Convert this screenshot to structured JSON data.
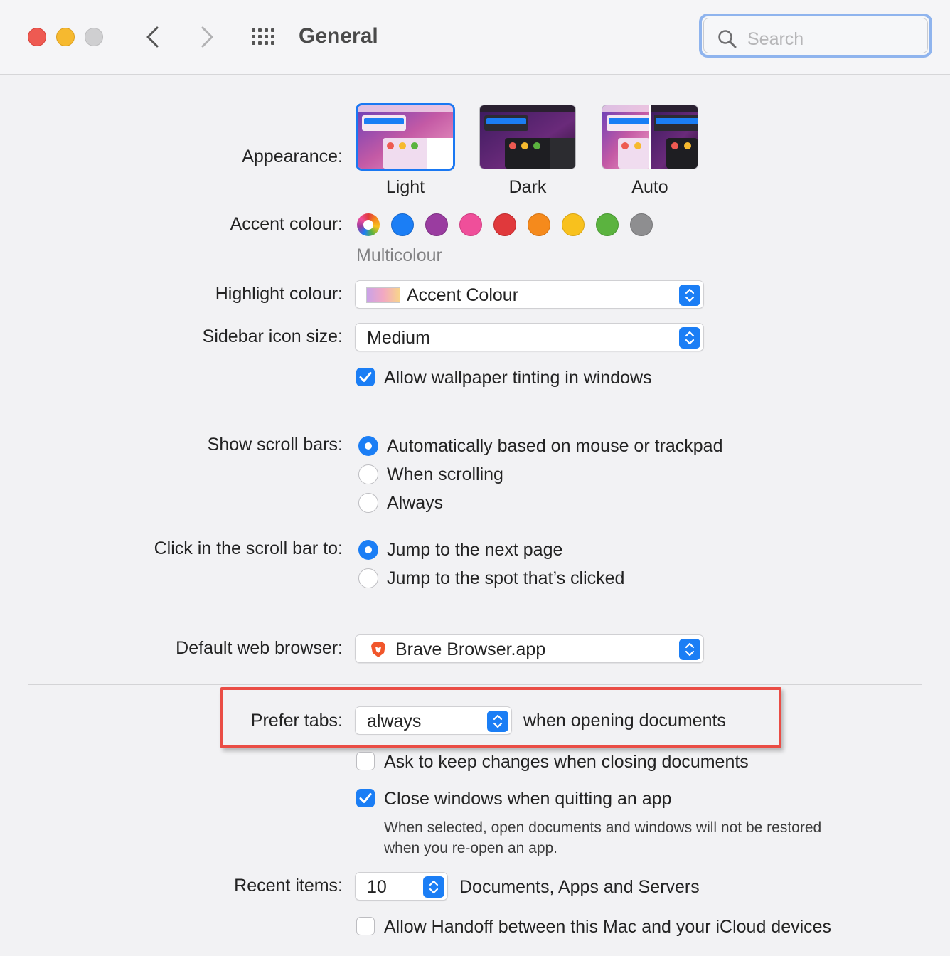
{
  "window": {
    "title": "General",
    "search_placeholder": "Search"
  },
  "appearance": {
    "label": "Appearance:",
    "options": [
      "Light",
      "Dark",
      "Auto"
    ],
    "selected": "Light"
  },
  "accent": {
    "label": "Accent colour:",
    "selected_name": "Multicolour",
    "colors": [
      "multicolour",
      "#1b7ef5",
      "#9a3ca0",
      "#ef4f9a",
      "#e0393c",
      "#f58a1c",
      "#f8c11d",
      "#5bb33f",
      "#8e8e90"
    ]
  },
  "highlight": {
    "label": "Highlight colour:",
    "value": "Accent Colour"
  },
  "sidebar_icon": {
    "label": "Sidebar icon size:",
    "value": "Medium"
  },
  "wallpaper_tinting": {
    "label": "Allow wallpaper tinting in windows",
    "checked": true
  },
  "scroll_bars": {
    "label": "Show scroll bars:",
    "options": [
      "Automatically based on mouse or trackpad",
      "When scrolling",
      "Always"
    ],
    "selected": "Automatically based on mouse or trackpad"
  },
  "click_scroll": {
    "label": "Click in the scroll bar to:",
    "options": [
      "Jump to the next page",
      "Jump to the spot that’s clicked"
    ],
    "selected": "Jump to the next page"
  },
  "browser": {
    "label": "Default web browser:",
    "value": "Brave Browser.app"
  },
  "prefer_tabs": {
    "label": "Prefer tabs:",
    "value": "always",
    "suffix": "when opening documents"
  },
  "ask_keep_changes": {
    "label": "Ask to keep changes when closing documents",
    "checked": false
  },
  "close_windows": {
    "label": "Close windows when quitting an app",
    "checked": true,
    "help_line1": "When selected, open documents and windows will not be restored",
    "help_line2": "when you re-open an app."
  },
  "recent_items": {
    "label": "Recent items:",
    "value": "10",
    "suffix": "Documents, Apps and Servers"
  },
  "handoff": {
    "label": "Allow Handoff between this Mac and your iCloud devices",
    "checked": false
  }
}
